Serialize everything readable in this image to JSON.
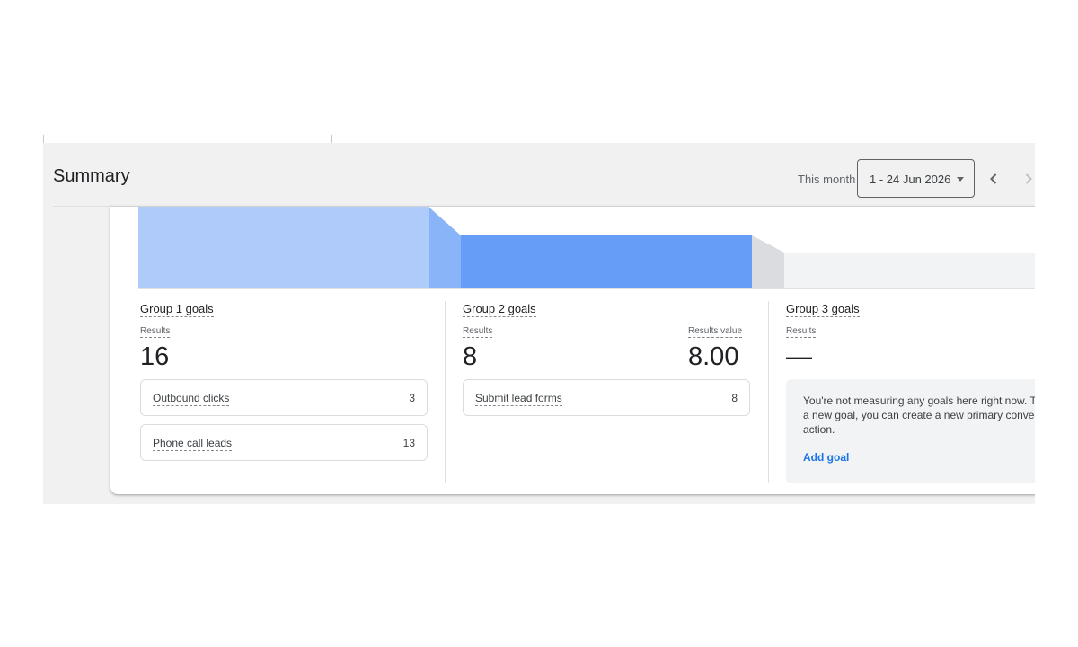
{
  "summary": {
    "title": "Summary",
    "period_label": "This month",
    "date_range": "1 - 24 Jun 2026"
  },
  "groups": [
    {
      "title": "Group 1 goals",
      "results_label": "Results",
      "results": "16",
      "conversions": [
        {
          "name": "Outbound clicks",
          "count": "3"
        },
        {
          "name": "Phone call leads",
          "count": "13"
        }
      ]
    },
    {
      "title": "Group 2 goals",
      "results_label": "Results",
      "results": "8",
      "value_label": "Results value",
      "value": "8.00",
      "conversions": [
        {
          "name": "Submit lead forms",
          "count": "8"
        }
      ]
    },
    {
      "title": "Group 3 goals",
      "results_label": "Results",
      "results": "—",
      "empty_message": "You're not measuring any goals here right now. To add a new goal, you can create a new primary conversion action.",
      "add_goal_label": "Add goal"
    }
  ],
  "colors": {
    "funnel_group1": "#aecbfa",
    "funnel_group2": "#669df6",
    "funnel_group3": "#f1f3f4",
    "accent": "#1a73e8"
  },
  "icons": {
    "prev": "chevron-left-icon",
    "next": "chevron-right-icon",
    "dropdown": "arrow-drop-down-icon"
  }
}
